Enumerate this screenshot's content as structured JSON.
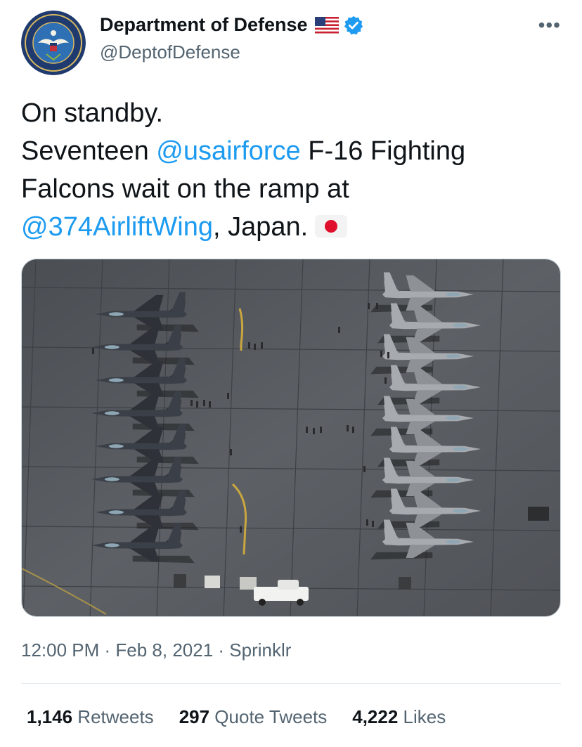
{
  "account": {
    "name": "Department of Defense",
    "handle": "@DeptofDefense",
    "seal_text": "DEPARTMENT OF DEFENSE · UNITED STATES OF AMERICA",
    "flag_icon": "us-flag-icon",
    "verified_icon": "verified-badge-icon",
    "more_icon": "more-options-icon"
  },
  "tweet": {
    "line1": "On standby.",
    "line2_pre": "Seventeen ",
    "mention1": "@usairforce",
    "line2_post": " F-16 Fighting",
    "line3": "Falcons wait on the ramp at",
    "mention2": "@374AirliftWing",
    "line4_post": ", Japan.",
    "emoji": "japan-flag-emoji"
  },
  "meta": {
    "time": "12:00 PM",
    "sep1": " · ",
    "date": "Feb 8, 2021",
    "sep2": " · ",
    "source": "Sprinklr"
  },
  "stats": {
    "retweets_count": "1,146",
    "retweets_label": " Retweets",
    "quotes_count": "297",
    "quotes_label": " Quote Tweets",
    "likes_count": "4,222",
    "likes_label": " Likes"
  },
  "colors": {
    "link": "#1d9bf0",
    "secondary": "#536471",
    "text": "#0f1419",
    "verified": "#1d9bf0",
    "tarmac": "#55595e"
  }
}
